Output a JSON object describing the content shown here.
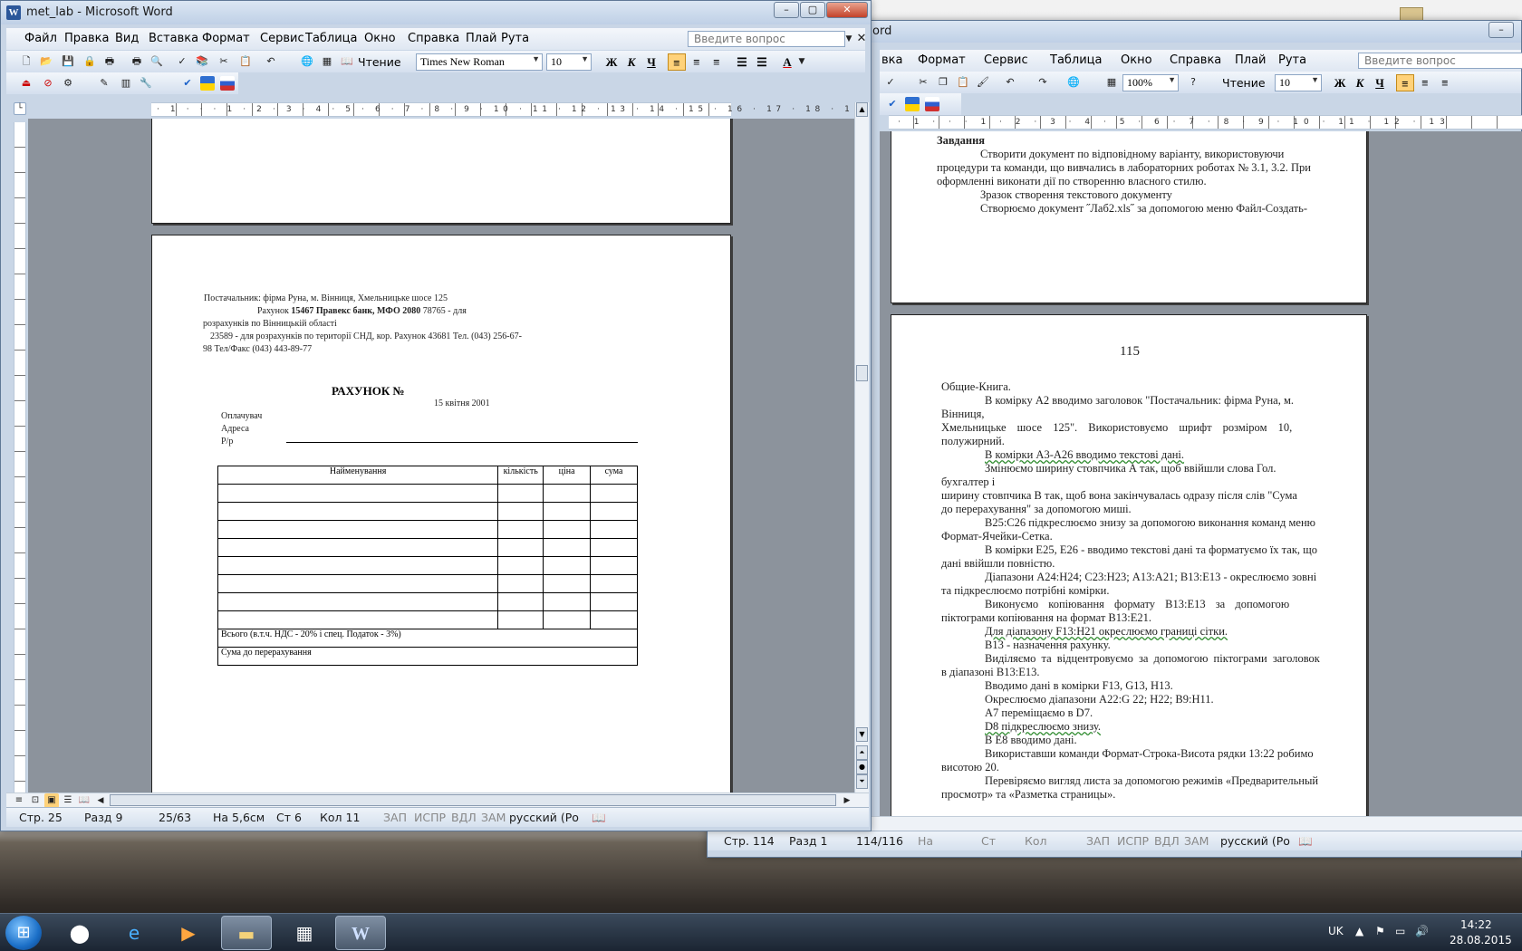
{
  "left_window": {
    "title": "met_lab - Microsoft Word",
    "menu": [
      "Файл",
      "Правка",
      "Вид",
      "Вставка",
      "Формат",
      "Сервис",
      "Таблица",
      "Окно",
      "Справка",
      "Плай",
      "Рута"
    ],
    "help_placeholder": "Введите вопрос",
    "reading_label": "Чтение",
    "font_name": "Times New Roman",
    "font_size": "10",
    "ruler_label": "· 1 · · · 1 · 2 · 3 · 4 · 5 · 6 · 7 · 8 · 9 · 10 · 11 · 12 · 13 · 14 · 15 · 16 · 17 · 18 · 19",
    "page_content": {
      "supplier_line": "Постачальник: фірма Руна, м. Вінниця, Хмельницьке шосе 125",
      "account_line_plain": "Рахунок ",
      "account_line_bold": "15467 Правекс банк, МФО 2080",
      "account_line_end": " 78765 - для",
      "settlement_line": "розрахунків по Вінницькій області",
      "cis_line": "23589 - для розрахунків по території СНД, кор. Рахунок 43681  Тел. (043) 256-67-",
      "phone_line": "98 Тел/Факс (043) 443-89-77",
      "invoice_title": "РАХУНОК №",
      "date": "15 квітня 2001",
      "payer": "Оплачувач",
      "address": "Адреса",
      "account_short": "Р/р",
      "table_headers": [
        "Найменування",
        "кількість",
        "ціна",
        "сума"
      ],
      "total_row": "Всього (в.т.ч. НДС - 20% і спец. Податок - 3%)",
      "sum_row": "Сума до перерахування"
    },
    "status": {
      "page": "Стр. 25",
      "section": "Разд 9",
      "pages": "25/63",
      "at": "На 5,6см",
      "line": "Ст 6",
      "col": "Кол 11",
      "rec": "ЗАП",
      "trk": "ИСПР",
      "ext": "ВДЛ",
      "ovr": "ЗАМ",
      "language": "русский (Ро"
    }
  },
  "right_window": {
    "title_fragment": "ord",
    "menu": [
      "вка",
      "Формат",
      "Сервис",
      "Таблица",
      "Окно",
      "Справка",
      "Плай",
      "Рута"
    ],
    "help_placeholder": "Введите вопрос",
    "zoom": "100%",
    "reading_label": "Чтение",
    "font_size": "10",
    "ruler_label": "· 1 · · · 1 · 2 · 3 · 4 · 5 · 6 · 7 · 8 · 9 · 10 · 11 · 12 · 13",
    "page1_lines": [
      "Завдання",
      "Створити документ по відповідному варіанту, використовуючи",
      "процедури та команди, що вивчались в лабораторних роботах № 3.1, 3.2. При",
      "оформленні виконати дії по створенню власного стилю.",
      "Зразок створення текстового документу",
      "Створюємо документ ˝Лаб2.xls˝ за допомогою меню Файл-Создать-"
    ],
    "page_number": "115",
    "page2_lines": [
      "Общие-Книга.",
      "В комірку А2 вводимо заголовок \"Постачальник: фірма Руна, м.",
      "Вінниця,",
      "Хмельницьке шосе 125\". Використовуємо шрифт розміром 10,",
      "полужирний.",
      "В комірки А3-А26 вводимо текстові дані.",
      "Змінюємо ширину стовпчика А так, щоб ввійшли слова Гол.",
      "бухгалтер і",
      "ширину стовпчика В так, щоб вона закінчувалась одразу після слів \"Сума",
      "до перерахування\" за допомогою миші.",
      "В25:С26 підкреслюємо знизу за допомогою виконання команд меню",
      "Формат-Ячейки-Сетка.",
      "В комірки Е25, Е26 - вводимо текстові дані та форматуємо їх так, що",
      "дані ввійшли повністю.",
      "Діапазони А24:Н24; С23:Н23; А13:А21; В13:Е13 - окреслюємо зовні",
      "та підкреслюємо потрібні комірки.",
      "Виконуємо копіювання формату В13:Е13 за допомогою",
      "піктограми копіювання на формат В13:Е21.",
      "Для діапазону F13:Н21 окреслюємо границі сітки.",
      "В13 - назначення рахунку.",
      "Виділяємо та відцентровуємо за допомогою піктограми заголовок",
      "в діапазоні В13:Е13.",
      "Вводимо дані в комірки F13, G13, Н13.",
      "Окреслюємо діапазони А22:G 22; Н22; В9:Н11.",
      "А7 переміщаємо в D7.",
      "D8 підкреслюємо знизу.",
      "В Е8 вводимо дані.",
      "Використавши команди Формат-Строка-Висота рядки 13:22 робимо",
      "висотою 20.",
      "Перевіряємо вигляд листа за допомогою режимів «Предварительный",
      "просмотр» та «Разметка страницы»."
    ],
    "status": {
      "page": "Стр. 114",
      "section": "Разд 1",
      "pages": "114/116",
      "at": "На",
      "line": "Ст",
      "col": "Кол",
      "rec": "ЗАП",
      "trk": "ИСПР",
      "ext": "ВДЛ",
      "ovr": "ЗАМ",
      "language": "русский (Ро"
    }
  },
  "taskbar": {
    "language": "UK",
    "time": "14:22",
    "date": "28.08.2015"
  },
  "colors": {
    "active_format": "#ffd27a",
    "window_frame": "#c9d6e6",
    "doc_background": "#8c939c"
  }
}
